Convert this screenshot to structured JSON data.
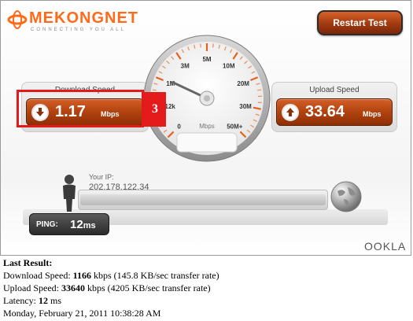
{
  "header": {
    "logo_text": "MEKONGNET",
    "logo_tagline": "CONNECTING YOU ALL",
    "restart_label": "Restart Test"
  },
  "download": {
    "title": "Download Speed",
    "value": "1.17",
    "unit": "Mbps"
  },
  "upload": {
    "title": "Upload Speed",
    "value": "33.64",
    "unit": "Mbps"
  },
  "gauge": {
    "ticks": [
      "0",
      "512k",
      "1M",
      "3M",
      "5M",
      "10M",
      "20M",
      "30M",
      "50M+"
    ],
    "unit_label": "Mbps",
    "needle_value": "1.17"
  },
  "annotation": {
    "badge": "3"
  },
  "ip": {
    "label": "Your IP:",
    "address": "202.178.122.34"
  },
  "ping": {
    "label": "PING:",
    "value": "12",
    "unit": "ms"
  },
  "branding": {
    "ookla": "OOKLA"
  },
  "last_result": {
    "heading": "Last Result:",
    "download_prefix": "Download Speed: ",
    "download_kbps": "1166",
    "download_suffix": " kbps (145.8 KB/sec transfer rate)",
    "upload_prefix": "Upload Speed: ",
    "upload_kbps": "33640",
    "upload_suffix": " kbps (4205 KB/sec transfer rate)",
    "latency_prefix": "Latency: ",
    "latency_value": "12",
    "latency_suffix": " ms",
    "timestamp": "Monday, February 21, 2011 10:38:28 AM"
  },
  "colors": {
    "accent": "#c2501a",
    "highlight": "#e21a1a"
  }
}
